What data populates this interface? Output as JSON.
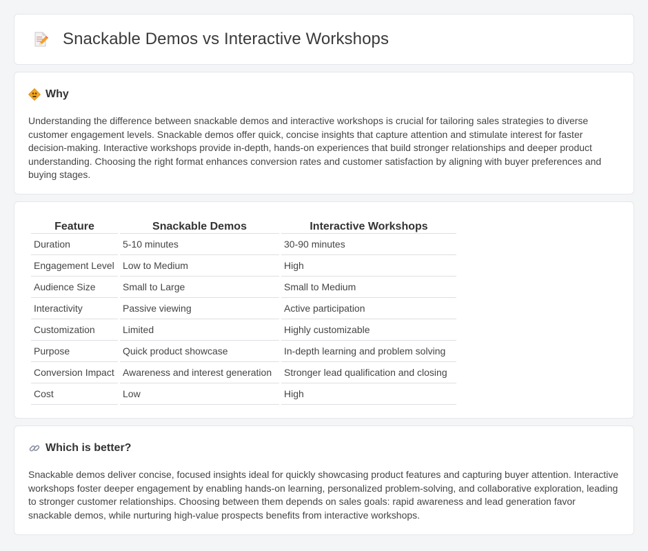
{
  "header": {
    "title": "Snackable Demos vs Interactive Workshops",
    "icon": "document-pencil-icon"
  },
  "why": {
    "icon": "diamond-sign-icon",
    "heading": "Why",
    "text": "Understanding the difference between snackable demos and interactive workshops is crucial for tailoring sales strategies to diverse customer engagement levels. Snackable demos offer quick, concise insights that capture attention and stimulate interest for faster decision-making. Interactive workshops provide in-depth, hands-on experiences that build stronger relationships and deeper product understanding. Choosing the right format enhances conversion rates and customer satisfaction by aligning with buyer preferences and buying stages."
  },
  "table": {
    "headers": [
      "Feature",
      "Snackable Demos",
      "Interactive Workshops"
    ],
    "rows": [
      [
        "Duration",
        "5-10 minutes",
        "30-90 minutes"
      ],
      [
        "Engagement Level",
        "Low to Medium",
        "High"
      ],
      [
        "Audience Size",
        "Small to Large",
        "Small to Medium"
      ],
      [
        "Interactivity",
        "Passive viewing",
        "Active participation"
      ],
      [
        "Customization",
        "Limited",
        "Highly customizable"
      ],
      [
        "Purpose",
        "Quick product showcase",
        "In-depth learning and problem solving"
      ],
      [
        "Conversion Impact",
        "Awareness and interest generation",
        "Stronger lead qualification and closing"
      ],
      [
        "Cost",
        "Low",
        "High"
      ]
    ]
  },
  "better": {
    "icon": "link-icon",
    "heading": "Which is better?",
    "text": "Snackable demos deliver concise, focused insights ideal for quickly showcasing product features and capturing buyer attention. Interactive workshops foster deeper engagement by enabling hands-on learning, personalized problem-solving, and collaborative exploration, leading to stronger customer relationships. Choosing between them depends on sales goals: rapid awareness and lead generation favor snackable demos, while nurturing high-value prospects benefits from interactive workshops."
  },
  "colors": {
    "background": "#f4f5f7",
    "card": "#ffffff",
    "border": "#e3e6ea",
    "text": "#444444"
  }
}
